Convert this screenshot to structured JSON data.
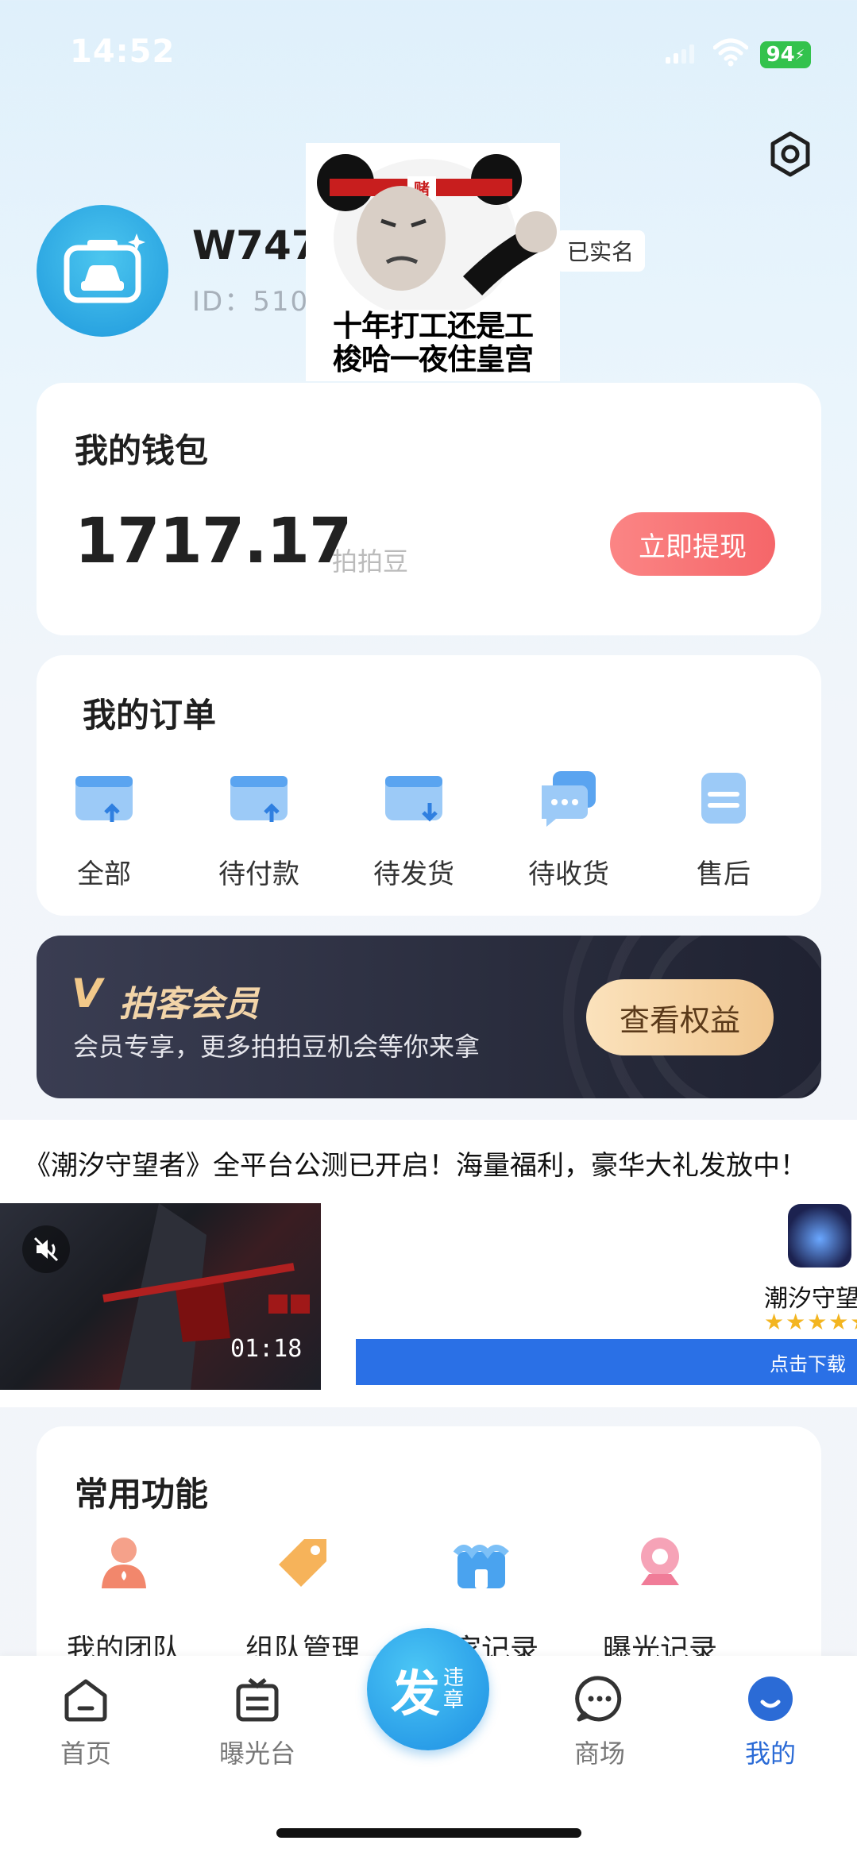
{
  "status_bar": {
    "time": "14:52",
    "battery": "94"
  },
  "profile": {
    "username": "W747",
    "id_text": "ID：510",
    "verified_badge": "已实名"
  },
  "meme_overlay": {
    "line1": "十年打工还是工",
    "line2": "梭哈一夜住皇宫",
    "headband": "赌"
  },
  "wallet": {
    "title": "我的钱包",
    "balance": "1717.17",
    "unit": "拍拍豆",
    "withdraw_label": "立即提现",
    "button_color": "#f56669"
  },
  "orders": {
    "title": "我的订单",
    "items": [
      {
        "label": "全部",
        "icon": "all-orders-icon"
      },
      {
        "label": "待付款",
        "icon": "pending-payment-icon"
      },
      {
        "label": "待发货",
        "icon": "pending-shipment-icon"
      },
      {
        "label": "待收货",
        "icon": "pending-receipt-icon"
      },
      {
        "label": "售后",
        "icon": "after-sales-icon"
      }
    ]
  },
  "vip": {
    "badge": "V",
    "title": "拍客会员",
    "subtitle": "会员专享，更多拍拍豆机会等你来拿",
    "button_label": "查看权益"
  },
  "ad": {
    "title": "《潮汐守望者》全平台公测已开启！海量福利，豪华大礼发放中！",
    "video_duration": "01:18",
    "app_name": "潮汐守望者",
    "stars": "★★★★★",
    "download_label": "点击下载"
  },
  "functions": {
    "title": "常用功能",
    "items": [
      {
        "label": "我的团队",
        "icon": "team-icon"
      },
      {
        "label": "组队管理",
        "icon": "team-manage-icon"
      },
      {
        "label": "商家记录",
        "icon": "merchant-record-icon"
      },
      {
        "label": "曝光记录",
        "icon": "exposure-record-icon"
      }
    ]
  },
  "tabbar": {
    "items": [
      {
        "label": "首页",
        "icon": "home-icon"
      },
      {
        "label": "曝光台",
        "icon": "exposure-board-icon"
      },
      {
        "label": "商场",
        "icon": "mall-icon"
      },
      {
        "label": "我的",
        "icon": "profile-icon"
      }
    ],
    "publish": {
      "main": "发",
      "sub": "违章"
    },
    "active": "我的",
    "accent": "#2b6bd6"
  }
}
